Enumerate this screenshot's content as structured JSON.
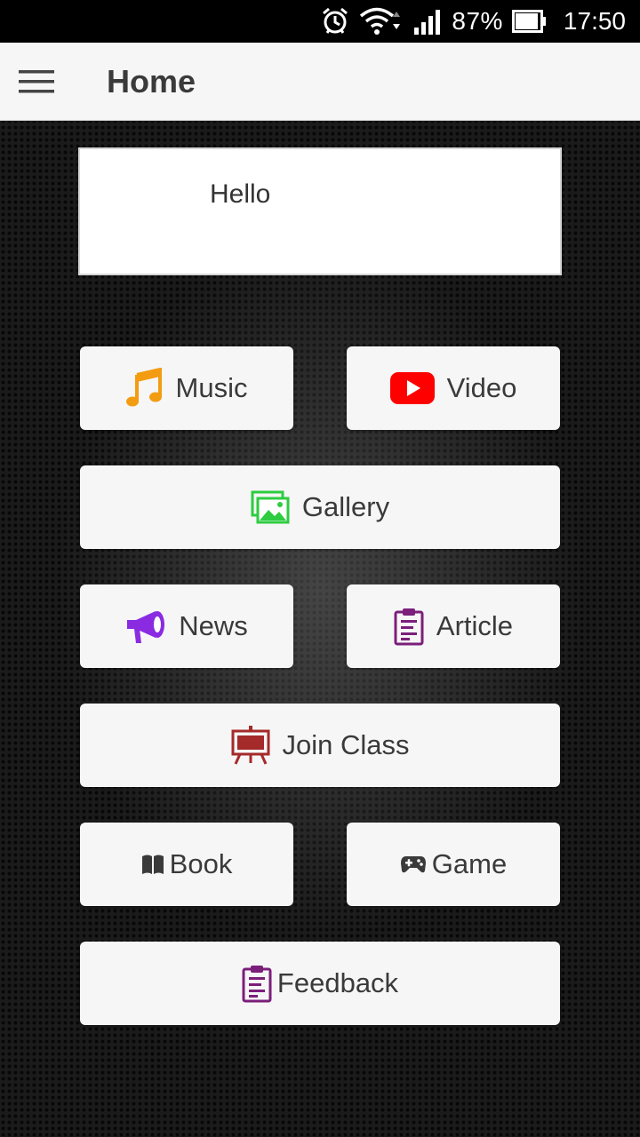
{
  "status_bar": {
    "battery_percent": "87%",
    "time": "17:50",
    "icons": [
      "alarm-icon",
      "wifi-icon",
      "signal-icon",
      "battery-icon"
    ]
  },
  "app_bar": {
    "title": "Home",
    "menu_icon": "hamburger-menu-icon"
  },
  "hello_card": {
    "text": "Hello"
  },
  "tiles": {
    "music": {
      "label": "Music",
      "icon": "music-note-icon",
      "icon_color": "#f39c12"
    },
    "video": {
      "label": "Video",
      "icon": "youtube-icon",
      "icon_color": "#ff0000"
    },
    "gallery": {
      "label": "Gallery",
      "icon": "gallery-icon",
      "icon_color": "#2ecc40"
    },
    "news": {
      "label": "News",
      "icon": "megaphone-icon",
      "icon_color": "#8a2be2"
    },
    "article": {
      "label": "Article",
      "icon": "clipboard-icon",
      "icon_color": "#7b1f7b"
    },
    "join_class": {
      "label": "Join Class",
      "icon": "easel-icon",
      "icon_color": "#a52a2a"
    },
    "book": {
      "label": "Book",
      "icon": "book-icon",
      "icon_color": "#3a3a3a"
    },
    "game": {
      "label": "Game",
      "icon": "gamepad-icon",
      "icon_color": "#3a3a3a"
    },
    "feedback": {
      "label": "Feedback",
      "icon": "clipboard-icon",
      "icon_color": "#7b1f7b"
    }
  }
}
